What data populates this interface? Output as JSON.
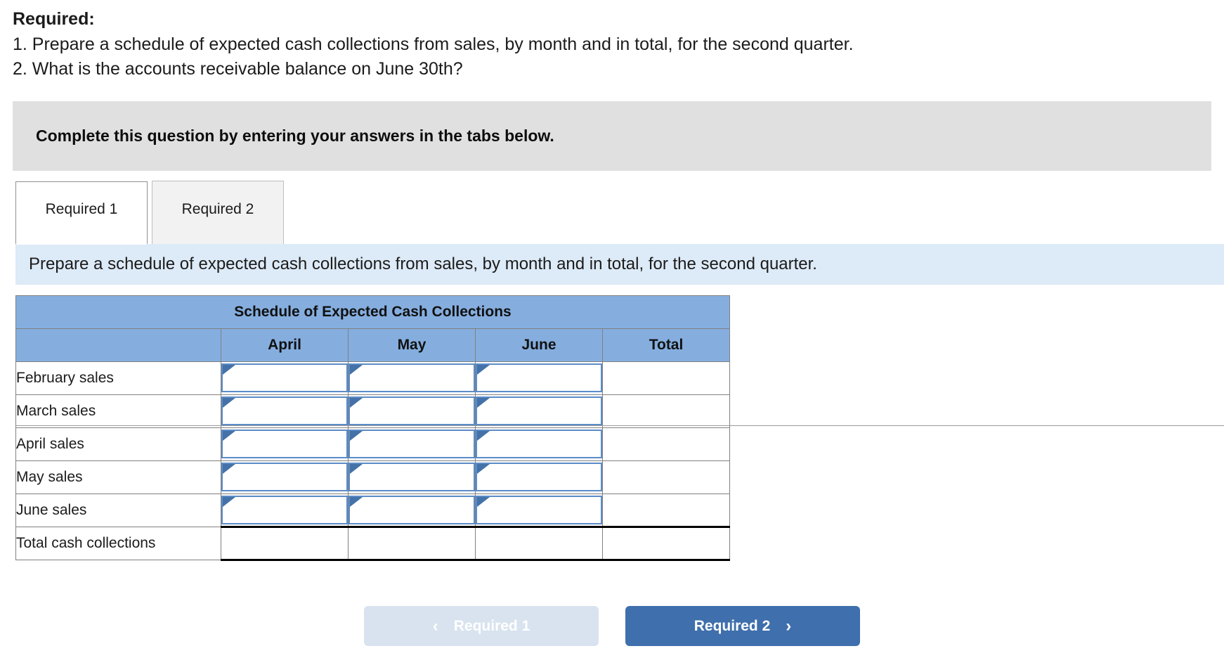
{
  "prompt": {
    "title": "Required:",
    "lines": [
      "1. Prepare a schedule of expected cash collections from sales, by month and in total, for the second quarter.",
      "2. What is the accounts receivable balance on June 30th?"
    ]
  },
  "banner": {
    "text": "Complete this question by entering your answers in the tabs below."
  },
  "tabs": [
    {
      "label": "Required 1",
      "active": true
    },
    {
      "label": "Required 2",
      "active": false
    }
  ],
  "subinstruction": {
    "text": "Prepare a schedule of expected cash collections from sales, by month and in total, for the second quarter."
  },
  "table": {
    "title": "Schedule of Expected Cash Collections",
    "corner_header": "",
    "column_headers": [
      "April",
      "May",
      "June",
      "Total"
    ],
    "rows": [
      {
        "label": "February sales",
        "cells": [
          "",
          "",
          ""
        ],
        "total": "",
        "input": true
      },
      {
        "label": "March sales",
        "cells": [
          "",
          "",
          ""
        ],
        "total": "",
        "input": true
      },
      {
        "label": "April sales",
        "cells": [
          "",
          "",
          ""
        ],
        "total": "",
        "input": true
      },
      {
        "label": "May sales",
        "cells": [
          "",
          "",
          ""
        ],
        "total": "",
        "input": true
      },
      {
        "label": "June sales",
        "cells": [
          "",
          "",
          ""
        ],
        "total": "",
        "input": true
      },
      {
        "label": "Total cash collections",
        "cells": [
          "",
          "",
          ""
        ],
        "total": "",
        "input": false
      }
    ]
  },
  "footer": {
    "prev_label": "Required 1",
    "prev_icon": "chevron-left-icon",
    "prev_chevron": "‹",
    "next_label": "Required 2",
    "next_icon": "chevron-right-icon",
    "next_chevron": "›"
  },
  "colors": {
    "table_header_blue": "#85aedf",
    "subinstruction_blue": "#ddeaf7",
    "banner_gray": "#e0e0e0",
    "input_border_blue": "#5b8cc8",
    "next_button_blue": "#3f6fac",
    "prev_button_blue": "#d8e3ef"
  }
}
